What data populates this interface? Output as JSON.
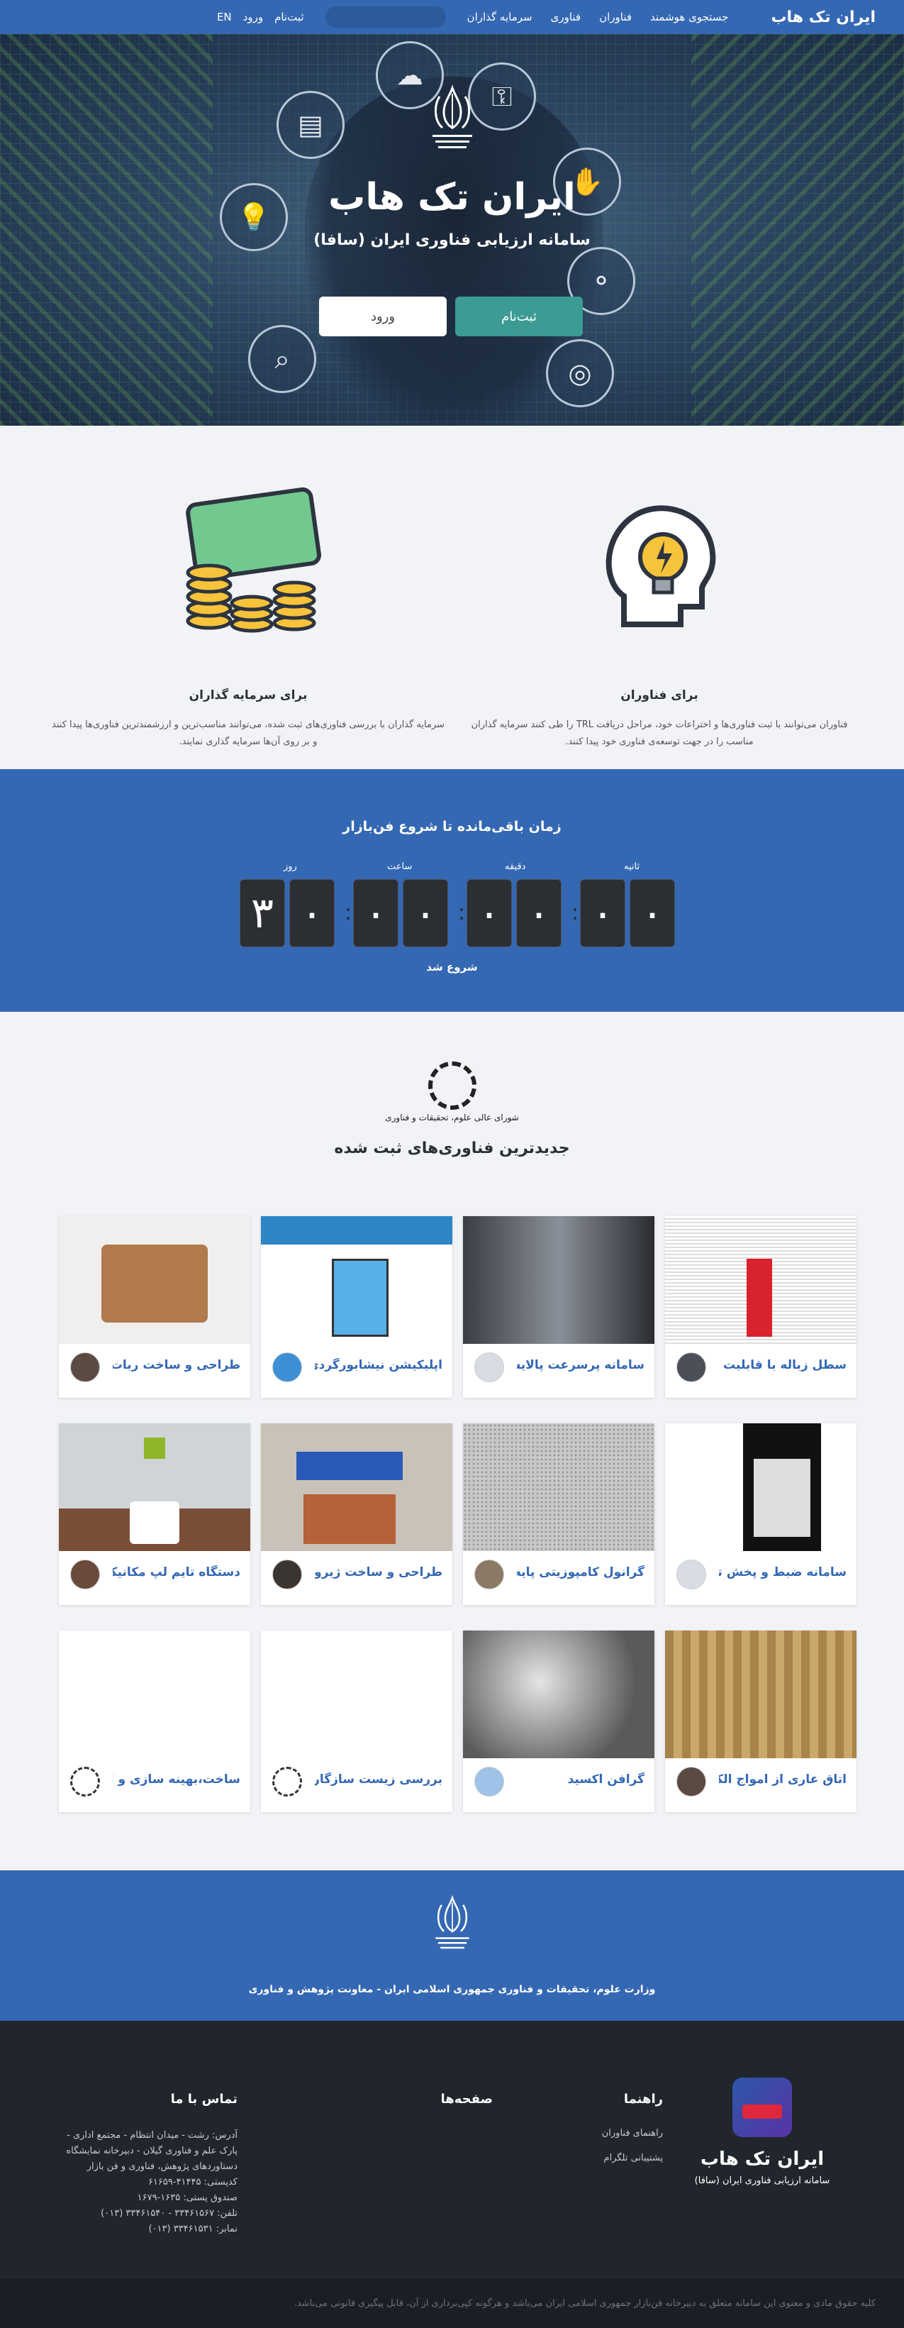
{
  "navbar": {
    "brand": "ایران تک هاب",
    "menu": [
      "جستجوی هوشمند",
      "فناوران",
      "فناوری",
      "سرمایه گذاران"
    ],
    "auth": [
      "ثبت‌نام",
      "ورود",
      "EN"
    ]
  },
  "hero": {
    "title": "ایران تک هاب",
    "subtitle": "سامانه ارزیابی فناوری ایران (سافا)",
    "register_label": "ثبت‌نام",
    "login_label": "ورود"
  },
  "features": {
    "technologists": {
      "title": "برای فناوران",
      "text": "فناوران می‌توانند با ثبت فناوری‌ها و اختراعات خود، مراحل دریافت TRL را طی کنند سرمایه گذاران مناسب را در جهت توسعه‌ی فناوری خود پیدا کنند."
    },
    "investors": {
      "title": "برای سرمایه گذاران",
      "text": "سرمایه گذاران با بررسی فناوری‌های ثبت شده، می‌توانند مناسب‌ترین و ارزشمندترین فناوری‌ها پیدا کنند و بر روی آن‌ها سرمایه گذاری نمایند."
    }
  },
  "countdown": {
    "heading": "زمان باقی‌مانده تا شروع فن‌بازار",
    "labels": [
      "ثانیه",
      "دقیقه",
      "ساعت",
      "روز"
    ],
    "digits": [
      "۰",
      "۰",
      "۰",
      "۰",
      "۰",
      "۰",
      "۰",
      "۳"
    ],
    "status": "شروع شد"
  },
  "latest": {
    "logo_text": "شورای عالی علوم، تحقیقات و فناوری",
    "heading": "جدیدترین فناوری‌های ثبت شده",
    "cards": [
      {
        "title": "سطل زباله با قابلیت تفک..."
      },
      {
        "title": "سامانه پرسرعت پالایش ..."
      },
      {
        "title": "اپلیکیشن نیشابورگردی"
      },
      {
        "title": "طراحی و ساخت ربات مسی..."
      },
      {
        "title": "سامانه ضبط و پخش ترا..."
      },
      {
        "title": "گرانول کامپوزیتی پایه پل..."
      },
      {
        "title": "طراحی و ساخت ژیروسک..."
      },
      {
        "title": "دستگاه تایم لپ مکانیکی..."
      },
      {
        "title": "اتاق عاری از امواج الکترو..."
      },
      {
        "title": "گرافن اکسید"
      },
      {
        "title": "بررسی زیست سازگاری و..."
      },
      {
        "title": "ساخت،بهینه سازی و اس..."
      }
    ]
  },
  "ministry": {
    "text": "وزارت علوم، تحقیقات و فناوری جمهوری اسلامی ایران - معاونت پژوهش و فناوری"
  },
  "footer": {
    "brand": "ایران تک هاب",
    "brand_sub": "سامانه ارزیابی فناوری ایران (سافا)",
    "guide_title": "راهنما",
    "guide_links": [
      "راهنمای فناوران",
      "پشتیبانی تلگرام"
    ],
    "pages_title": "صفحه‌ها",
    "contact_title": "تماس با ما",
    "contact_lines": [
      "آدرس: رشت - میدان انتظام - مجتمع اداری -",
      "پارک علم و فناوری گیلان - دبیرخانه نمایشگاه",
      "دستاوردهای پژوهش، فناوری و فن بازار",
      "کدپستی: ۴۱۴۴۵-۶۱۶۵۹",
      "صندوق پستی: ۱۶۳۵-۱۶۷۹",
      "تلفن: ۳۳۴۶۱۵۶۷ - ۳۳۴۶۱۵۴۰ (۰۱۳)",
      "نمابر: ۳۳۴۶۱۵۳۱ (۰۱۳)"
    ],
    "copyright": "کلیه حقوق مادی و معنوی این سامانه متعلق به دبیرخانه فن‌بازار جمهوری اسلامی ایران می‌باشد و هرگونه کپی‌برداری از آن، قابل پیگیری قانونی می‌باشد."
  }
}
